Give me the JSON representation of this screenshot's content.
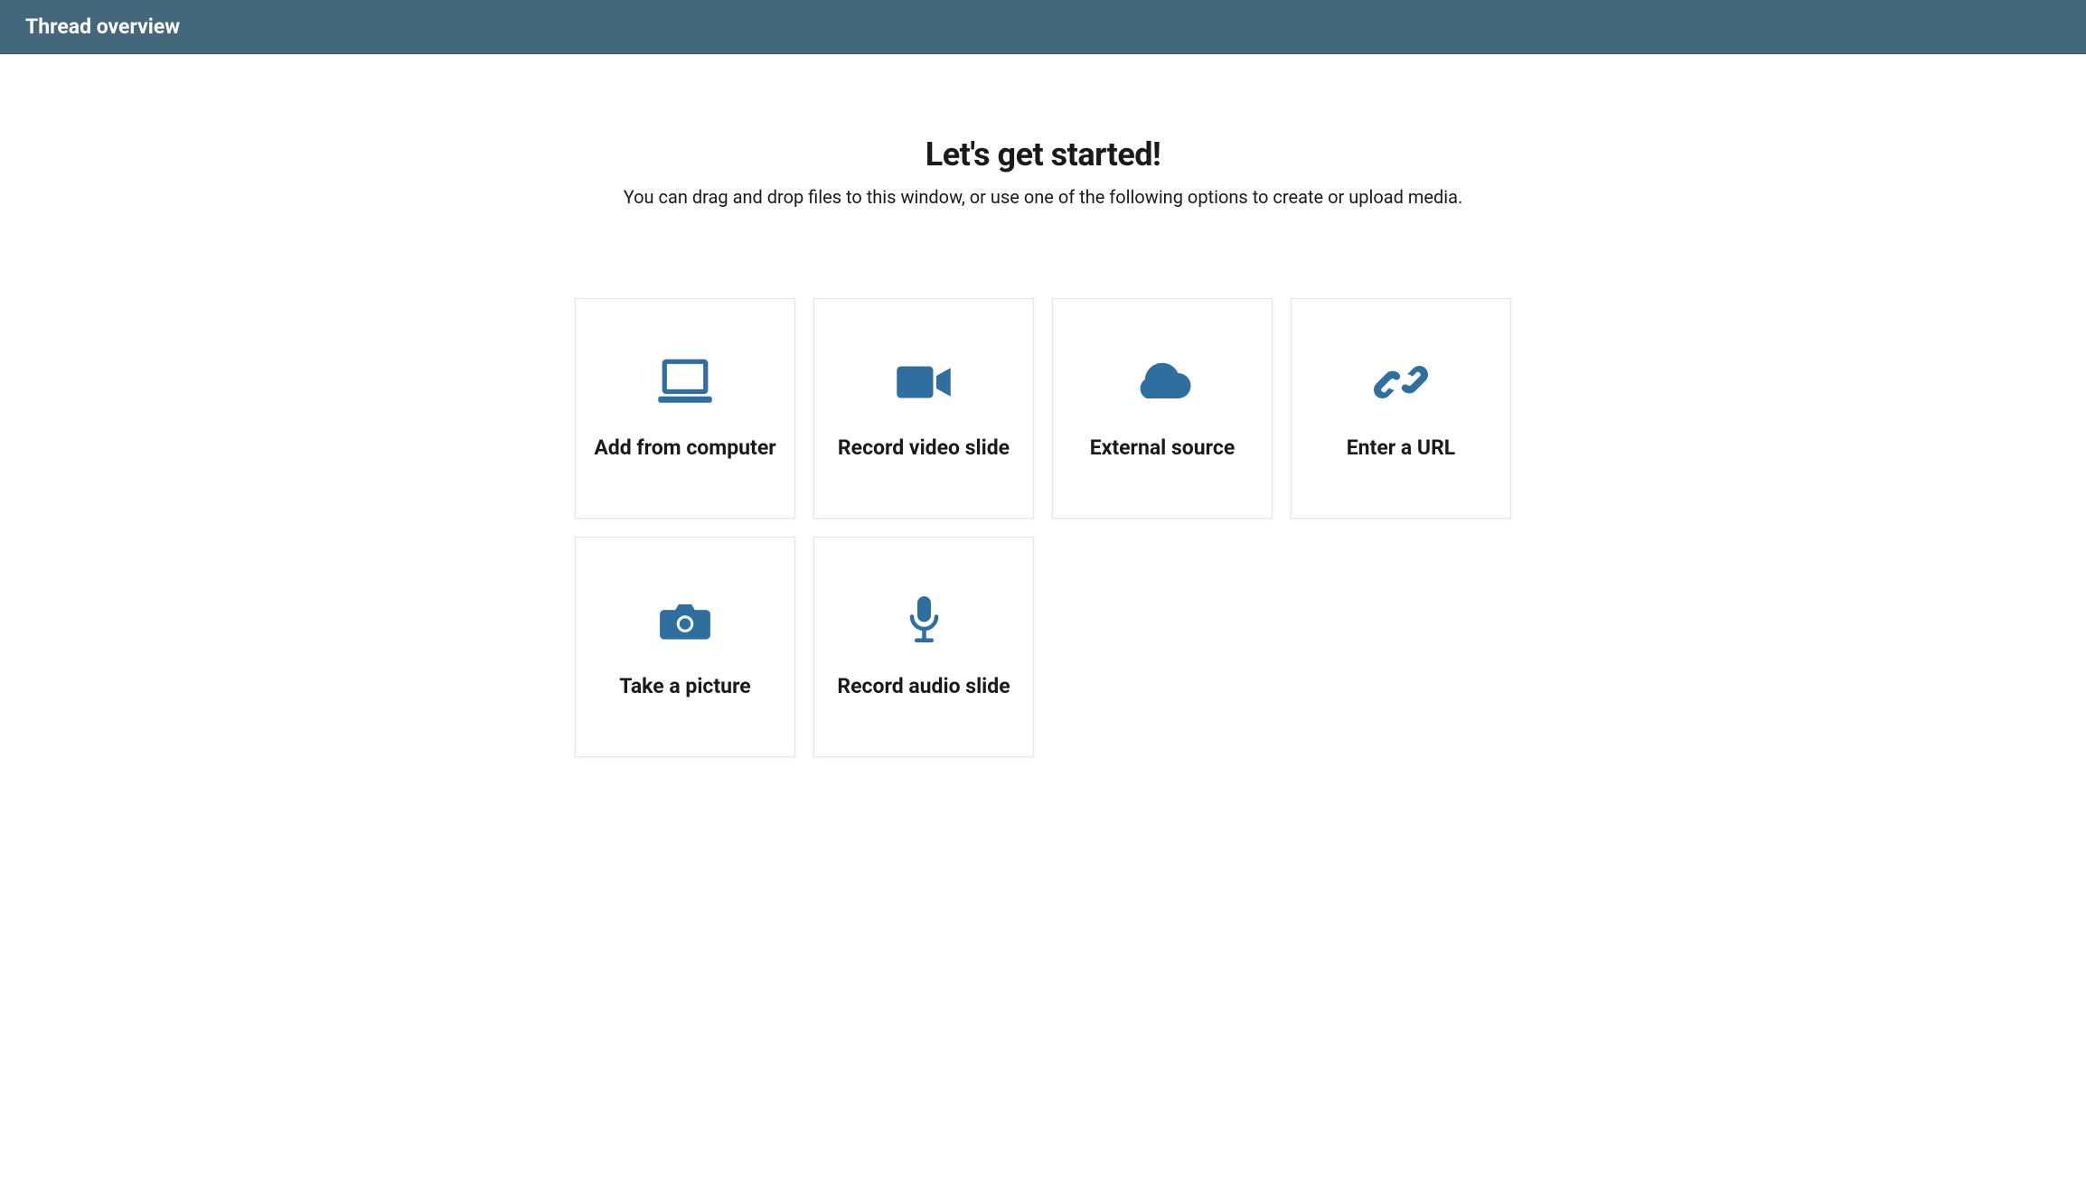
{
  "header": {
    "title": "Thread overview"
  },
  "main": {
    "title": "Let's get started!",
    "subtitle": "You can drag and drop files to this window, or use one of the following options to create or upload media."
  },
  "options": [
    {
      "label": "Add from computer",
      "icon": "laptop-icon"
    },
    {
      "label": "Record video slide",
      "icon": "video-icon"
    },
    {
      "label": "External source",
      "icon": "cloud-icon"
    },
    {
      "label": "Enter a URL",
      "icon": "link-icon"
    },
    {
      "label": "Take a picture",
      "icon": "camera-icon"
    },
    {
      "label": "Record audio slide",
      "icon": "microphone-icon"
    }
  ],
  "colors": {
    "header_bg": "#43687b",
    "icon": "#2f6f9f"
  }
}
